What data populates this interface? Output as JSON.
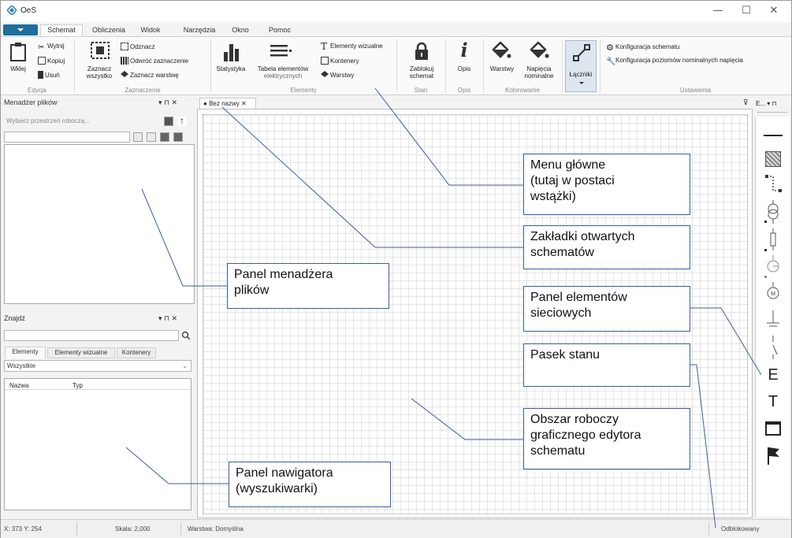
{
  "window": {
    "title": "OeS",
    "minimize": "—",
    "maximize": "☐",
    "close": "✕"
  },
  "ribbon_tabs": [
    "Schemat",
    "Obliczenia",
    "Widok",
    "Narzędzia",
    "Okno",
    "Pomoc"
  ],
  "ribbon": {
    "edycja": {
      "paste": "Wklej",
      "cut": "Wytnij",
      "copy": "Kopiuj",
      "delete": "Usuń",
      "group": "Edycja"
    },
    "zaznaczenie": {
      "select_all_1": "Zaznacz",
      "select_all_2": "wszystko",
      "deselect": "Odznacz",
      "invert": "Odwróć zaznaczenie",
      "select_layer": "Zaznacz warstwę",
      "group": "Zaznaczenie"
    },
    "elementy": {
      "stats": "Statystyka",
      "table_1": "Tabela elementów",
      "table_2": "elektrycznych",
      "visual": "Elementy wizualne",
      "containers": "Kontenery",
      "layers": "Warstwy",
      "group": "Elementy"
    },
    "stan": {
      "lock_1": "Zablokuj",
      "lock_2": "schemat",
      "group": "Stan"
    },
    "opis": {
      "desc": "Opis",
      "group": "Opis"
    },
    "kolorowanie": {
      "layers": "Warstwy",
      "voltages_1": "Napięcia",
      "voltages_2": "nominalne",
      "group": "Kolorowanie"
    },
    "lacznik": {
      "label": "Łączniki"
    },
    "ustawienia": {
      "schema_config": "Konfiguracja schematu",
      "voltage_config": "Konfiguracja poziomów nominalnych napięcia",
      "group": "Ustawienia"
    }
  },
  "file_manager": {
    "title": "Menadżer plików",
    "pin": "▾  ⊓  ✕",
    "workspace_placeholder": "Wybierz przestrzeń roboczą..."
  },
  "finder": {
    "title": "Znajdź",
    "pin": "▾  ⊓  ✕",
    "tabs": [
      "Elementy",
      "Elementy wizualne",
      "Kontenery"
    ],
    "filter_value": "Wszystkie",
    "columns": [
      "Nazwa",
      "Typ"
    ]
  },
  "document": {
    "tab_label": "Bez nazwy",
    "tab_close": "✕",
    "menu": "⊽"
  },
  "elements_panel": {
    "header": "E... ▾ ⊓",
    "text_items": [
      "E",
      "T"
    ]
  },
  "status": {
    "coords": "X: 373 Y: 254",
    "scale": "Skala: 2,000",
    "layer": "Warstwa: Domyślna",
    "lock_state": "Odblokowany"
  },
  "callouts": {
    "menu": [
      "Menu główne",
      "(tutaj w postaci",
      "wstążki)"
    ],
    "tabs": [
      "Zakładki otwartych",
      "schematów"
    ],
    "file_manager": [
      "Panel menadżera",
      "plików"
    ],
    "elements": [
      "Panel elementów",
      "sieciowych"
    ],
    "statusbar": [
      "Pasek stanu"
    ],
    "workspace": [
      "Obszar roboczy",
      "graficznego edytora",
      "schematu"
    ],
    "navigator": [
      "Panel nawigatora",
      "(wyszukiwarki)"
    ]
  },
  "colors": {
    "accent": "#1e6e9e",
    "callout_border": "#3b5d9a",
    "grid": "#e4e4e4"
  }
}
